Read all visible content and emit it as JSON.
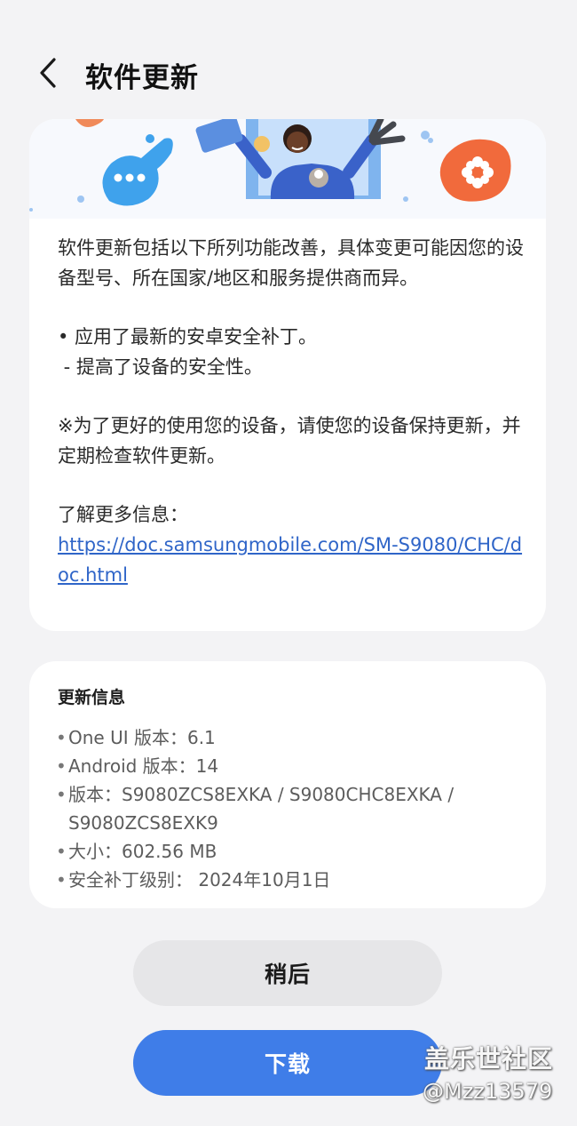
{
  "header": {
    "title": "软件更新"
  },
  "notes": {
    "intro": "软件更新包括以下所列功能改善，具体变更可能因您的设备型号、所在国家/地区和服务提供商而异。",
    "bullet1": "• 应用了最新的安卓安全补丁。",
    "bullet1_sub": " - 提高了设备的安全性。",
    "reminder": "※为了更好的使用您的设备，请使您的设备保持更新，并定期检查软件更新。",
    "learn_more": "了解更多信息：",
    "link": "https://doc.samsungmobile.com/SM-S9080/CHC/doc.html"
  },
  "info": {
    "title": "更新信息",
    "items": [
      "One UI 版本：6.1",
      "Android 版本：14",
      "版本：S9080ZCS8EXKA / S9080CHC8EXKA / S9080ZCS8EXK9",
      "大小：602.56 MB",
      "安全补丁级别： 2024年10月1日"
    ]
  },
  "buttons": {
    "later": "稍后",
    "download": "下载"
  },
  "watermark": {
    "line1": "盖乐世社区",
    "line2": "@Mzz13579"
  },
  "colors": {
    "accent": "#3f7de8",
    "link": "#2f65c8",
    "secondary_button": "#e6e6e8",
    "background": "#f3f3f5"
  }
}
